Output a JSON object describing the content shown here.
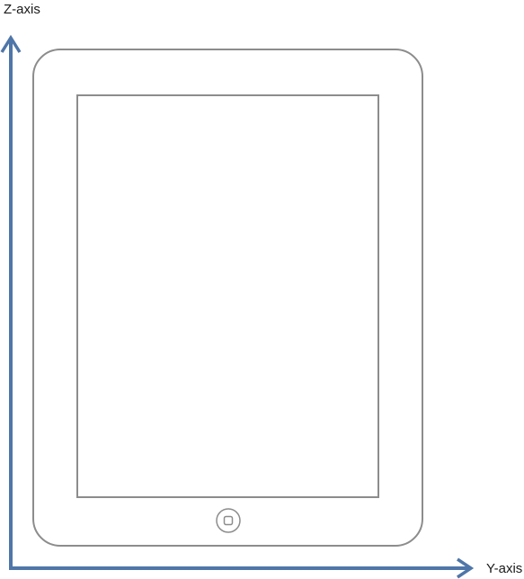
{
  "diagram": {
    "z_axis_label": "Z-axis",
    "y_axis_label": "Y-axis"
  },
  "colors": {
    "axis": "#4f76a8",
    "device_outline": "#8c8c8c",
    "background": "#ffffff"
  }
}
